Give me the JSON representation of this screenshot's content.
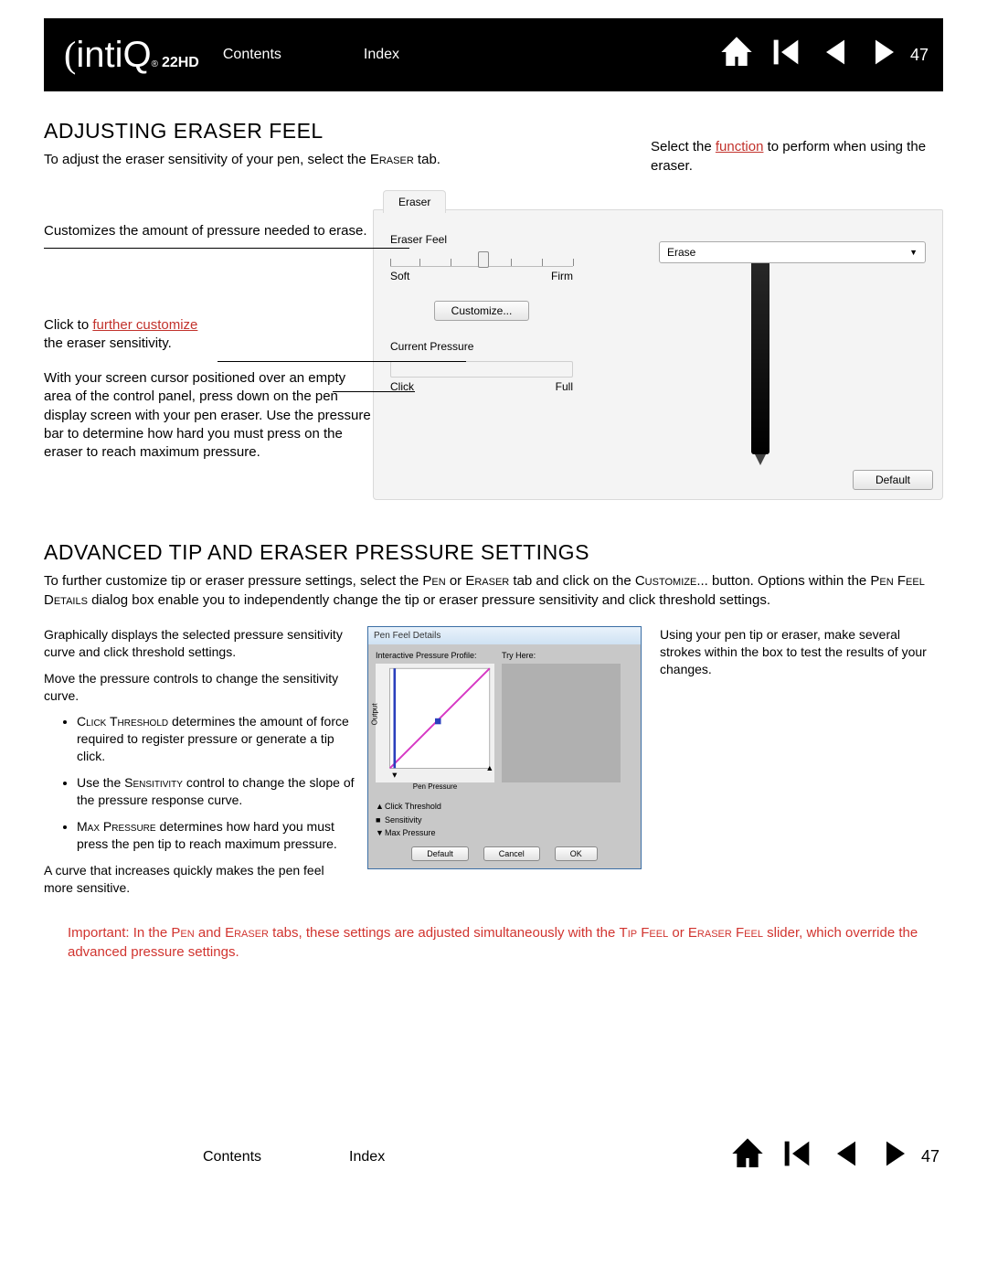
{
  "header": {
    "logo_brand": "intiQ",
    "logo_model": "22HD",
    "contents": "Contents",
    "index": "Index",
    "page_number": "47"
  },
  "section1": {
    "heading": "ADJUSTING ERASER FEEL",
    "intro_pre": "To adjust the eraser sensitivity of your pen, select the ",
    "intro_sc": "Eraser",
    "intro_post": " tab.",
    "anno_pressure": "Customizes the amount of pressure needed to erase.",
    "anno_customize_pre": "Click to ",
    "anno_customize_link": "further customize",
    "anno_customize_post": " the eraser sensitivity.",
    "anno_cursor": "With your screen cursor positioned over an empty area of the control panel, press down on the pen display screen with your pen eraser.  Use the pressure bar to determine how hard you must press on the eraser to reach maximum pressure.",
    "anno_function_pre": "Select the ",
    "anno_function_link": "function",
    "anno_function_post": " to perform when using the eraser.",
    "panel": {
      "tab_label": "Eraser",
      "feel_label": "Eraser Feel",
      "soft": "Soft",
      "firm": "Firm",
      "customize_btn": "Customize...",
      "current_pressure": "Current Pressure",
      "click": "Click",
      "full": "Full",
      "erase_option": "Erase",
      "default_btn": "Default"
    }
  },
  "section2": {
    "heading": "ADVANCED TIP AND ERASER PRESSURE SETTINGS",
    "intro_1": "To further customize tip or eraser pressure settings, select the ",
    "intro_sc1": "Pen",
    "intro_2": " or ",
    "intro_sc2": "Eraser",
    "intro_3": " tab and click on the ",
    "intro_sc3": "Customize",
    "intro_4": "... button.  Options within the ",
    "intro_sc4": "Pen Feel Details",
    "intro_5": " dialog box enable you to independently change the tip or eraser pressure sensitivity and click threshold settings.",
    "left_p1": "Graphically displays the selected pressure sensitivity curve and click threshold settings.",
    "left_p2": "Move the pressure controls to change the sensitivity curve.",
    "bullet1_sc": "Click Threshold",
    "bullet1_post": " determines the amount of force required to register pressure or generate a tip click.",
    "bullet2_pre": "Use the ",
    "bullet2_sc": "Sensitivity",
    "bullet2_post": " control to change the slope of the pressure response curve.",
    "bullet3_sc": "Max Pressure",
    "bullet3_post": " determines how hard you must press the pen tip to reach maximum pressure.",
    "left_p3": "A curve that increases quickly makes the pen feel more sensitive.",
    "right_p": "Using your pen tip or eraser, make several strokes within the box to test the results of your changes.",
    "dialog": {
      "title": "Pen Feel Details",
      "profile": "Interactive Pressure Profile:",
      "tryhere": "Try Here:",
      "output": "Output",
      "xaxis": "Pen Pressure",
      "ct": "Click Threshold",
      "sens": "Sensitivity",
      "maxp": "Max Pressure",
      "default": "Default",
      "cancel": "Cancel",
      "ok": "OK"
    },
    "important_1": "Important: In the ",
    "important_sc1": "Pen",
    "important_2": " and ",
    "important_sc2": "Eraser",
    "important_3": " tabs, these settings are adjusted simultaneously with the ",
    "important_sc3": "Tip Feel",
    "important_4": " or ",
    "important_sc4": "Eraser Feel",
    "important_5": " slider, which override the advanced pressure settings."
  },
  "footer": {
    "contents": "Contents",
    "index": "Index",
    "page_number": "47"
  }
}
